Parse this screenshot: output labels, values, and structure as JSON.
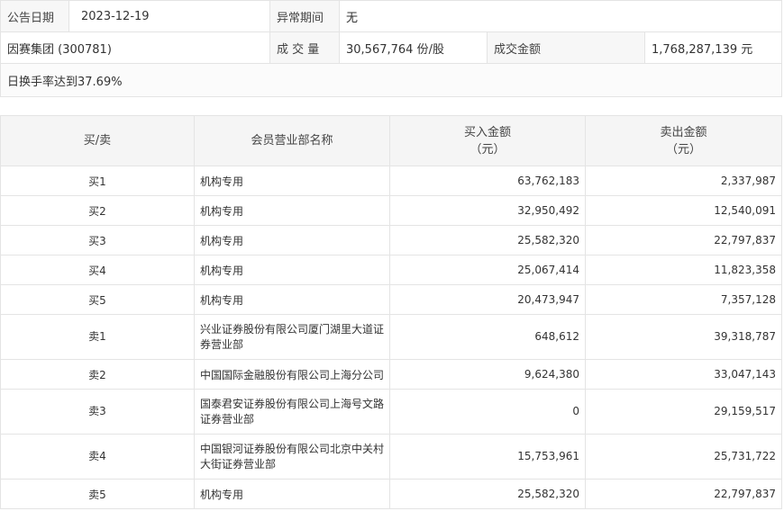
{
  "info": {
    "date_label": "公告日期",
    "date_value": "2023-12-19",
    "period_label": "异常期间",
    "period_value": "无",
    "stock": "因赛集团 (300781)",
    "volume_label": "成 交 量",
    "volume_value": "30,567,764 份/股",
    "amount_label": "成交金额",
    "amount_value": "1,768,287,139 元",
    "reason": "日换手率达到37.69%"
  },
  "table": {
    "headers": {
      "side": "买/卖",
      "name": "会员营业部名称",
      "buy": "买入金额",
      "buy_unit": "（元）",
      "sell": "卖出金额",
      "sell_unit": "（元）"
    },
    "rows": [
      {
        "side": "买1",
        "name": "机构专用",
        "buy": "63,762,183",
        "sell": "2,337,987"
      },
      {
        "side": "买2",
        "name": "机构专用",
        "buy": "32,950,492",
        "sell": "12,540,091"
      },
      {
        "side": "买3",
        "name": "机构专用",
        "buy": "25,582,320",
        "sell": "22,797,837"
      },
      {
        "side": "买4",
        "name": "机构专用",
        "buy": "25,067,414",
        "sell": "11,823,358"
      },
      {
        "side": "买5",
        "name": "机构专用",
        "buy": "20,473,947",
        "sell": "7,357,128"
      },
      {
        "side": "卖1",
        "name": "兴业证券股份有限公司厦门湖里大道证券营业部",
        "buy": "648,612",
        "sell": "39,318,787"
      },
      {
        "side": "卖2",
        "name": "中国国际金融股份有限公司上海分公司",
        "buy": "9,624,380",
        "sell": "33,047,143"
      },
      {
        "side": "卖3",
        "name": "国泰君安证券股份有限公司上海号文路证券营业部",
        "buy": "0",
        "sell": "29,159,517"
      },
      {
        "side": "卖4",
        "name": "中国银河证券股份有限公司北京中关村大街证券营业部",
        "buy": "15,753,961",
        "sell": "25,731,722"
      },
      {
        "side": "卖5",
        "name": "机构专用",
        "buy": "25,582,320",
        "sell": "22,797,837"
      }
    ]
  }
}
